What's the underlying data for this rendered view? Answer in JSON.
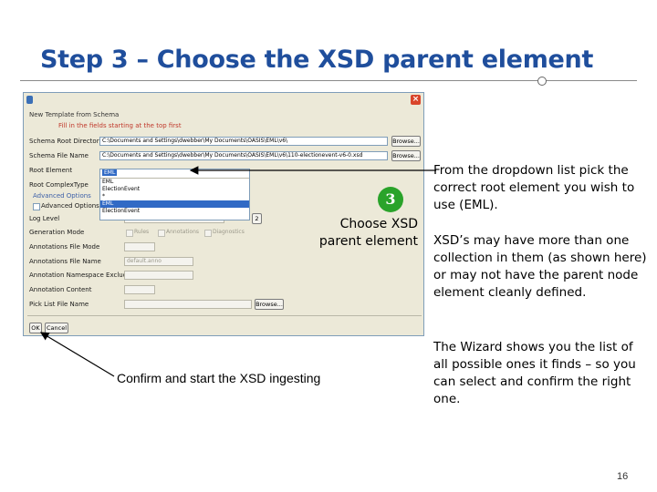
{
  "slide": {
    "title": "Step 3 – Choose the XSD parent element",
    "page_number": "16"
  },
  "dialog": {
    "subtitle": "New Template from Schema",
    "hint": "Fill in the fields starting at the top first",
    "close_icon": "close-x-icon",
    "labels": {
      "schema_root_directory": "Schema Root Directory",
      "schema_file_name": "Schema File Name",
      "root_element": "Root Element",
      "root_complex_type": "Root ComplexType",
      "advanced_options": "Advanced Options",
      "advanced_checkbox": "Advanced Options",
      "log_level": "Log Level",
      "generation_mode": "Generation Mode",
      "annotations_file_mode": "Annotations File Mode",
      "annotations_file_name": "Annotations File Name",
      "annotation_namespace_exclude": "Annotation Namespace Exclude",
      "annotation_content": "Annotation Content",
      "pick_list_file_name": "Pick List File Name"
    },
    "values": {
      "schema_root_directory": "C:\\Documents and Settings\\dwebber\\My Documents\\OASIS\\EML\\v6\\",
      "schema_file_name": "C:\\Documents and Settings\\dwebber\\My Documents\\OASIS\\EML\\v6\\110-electionevent-v6-0.xsd",
      "root_element": "EML",
      "log_level_number": "2",
      "annotations_file_name": "default.anno"
    },
    "root_element_options": [
      "EML",
      "ElectionEvent",
      "*",
      "EML",
      "ElectionEvent"
    ],
    "root_element_selected_index": 3,
    "generation_options": [
      "Rules",
      "Annotations",
      "Diagnostics"
    ],
    "buttons": {
      "browse": "Browse...",
      "ok": "OK",
      "cancel": "Cancel"
    }
  },
  "annotations": {
    "badge_number": "3",
    "choose_callout": "Choose XSD parent element",
    "confirm_caption": "Confirm and start the XSD ingesting"
  },
  "notes": {
    "dropdown_note": "From the dropdown list pick the correct root element you wish to use (EML).",
    "collection_note": "XSD’s may have more than one collection in them (as shown here) or may not have the parent node element cleanly defined.",
    "wizard_note": "The Wizard shows you the list of all possible ones it finds – so you can select and confirm the right one."
  },
  "colors": {
    "title": "#1f4e9c",
    "hint_text": "#c0382b",
    "selection": "#316ac5",
    "badge": "#2aa32a"
  }
}
